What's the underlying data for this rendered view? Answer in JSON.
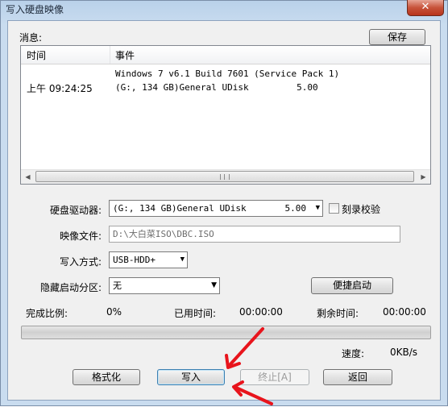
{
  "window": {
    "title": "写入硬盘映像",
    "close_glyph": "✕"
  },
  "messages": {
    "label": "消息:",
    "save_button": "保存",
    "columns": [
      "时间",
      "事件"
    ],
    "rows": [
      {
        "time": "",
        "event": "Windows 7 v6.1 Build 7601 (Service Pack 1)"
      },
      {
        "time": "上午 09:24:25",
        "event": "(G:, 134 GB)General UDisk         5.00"
      }
    ]
  },
  "form": {
    "drive_label": "硬盘驱动器:",
    "drive_value": "(G:, 134 GB)General UDisk",
    "drive_rev": "5.00",
    "verify_label": "刻录校验",
    "image_label": "映像文件:",
    "image_value": "D:\\大白菜ISO\\DBC.ISO",
    "method_label": "写入方式:",
    "method_value": "USB-HDD+",
    "hide_label": "隐藏启动分区:",
    "hide_value": "无",
    "quick_boot_button": "便捷启动"
  },
  "status": {
    "complete_label": "完成比例:",
    "complete_value": "0%",
    "elapsed_label": "已用时间:",
    "elapsed_value": "00:00:00",
    "remaining_label": "剩余时间:",
    "remaining_value": "00:00:00",
    "speed_label": "速度:",
    "speed_value": "0KB/s",
    "progress_fraction": 0.0
  },
  "buttons": {
    "format": "格式化",
    "write": "写入",
    "abort": "终止[A]",
    "back": "返回"
  },
  "icons": {
    "dropdown": "dropdown-arrow-icon",
    "scroll_left": "scroll-left-icon",
    "scroll_right": "scroll-right-icon"
  },
  "colors": {
    "annotation_arrow": "#e8141c",
    "titlebar": "#b9d1ea",
    "close_button": "#c7533a"
  }
}
